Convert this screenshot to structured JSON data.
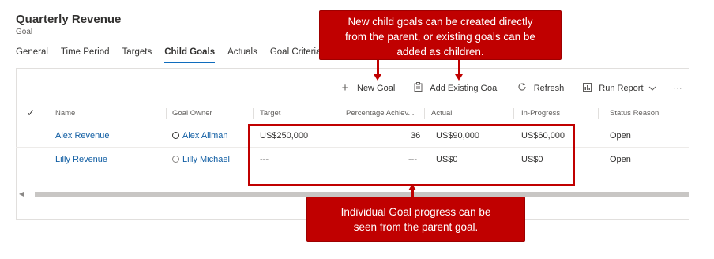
{
  "header": {
    "title": "Quarterly Revenue",
    "subtitle": "Goal"
  },
  "tabs": [
    {
      "label": "General"
    },
    {
      "label": "Time Period"
    },
    {
      "label": "Targets"
    },
    {
      "label": "Child Goals"
    },
    {
      "label": "Actuals"
    },
    {
      "label": "Goal Criteria"
    }
  ],
  "toolbar": {
    "new_goal": "New Goal",
    "add_existing_goal": "Add Existing Goal",
    "refresh": "Refresh",
    "run_report": "Run Report",
    "more": "···"
  },
  "columns": {
    "check": "✓",
    "name": "Name",
    "goal_owner": "Goal Owner",
    "target": "Target",
    "percentage": "Percentage Achiev...",
    "actual": "Actual",
    "in_progress": "In-Progress",
    "status_reason": "Status Reason"
  },
  "rows": [
    {
      "name": "Alex Revenue",
      "owner": "Alex Allman",
      "target": "US$250,000",
      "percentage": "36",
      "actual": "US$90,000",
      "in_progress": "US$60,000",
      "status": "Open"
    },
    {
      "name": "Lilly Revenue",
      "owner": "Lilly Michael",
      "target": "---",
      "percentage": "---",
      "actual": "US$0",
      "in_progress": "US$0",
      "status": "Open"
    }
  ],
  "callouts": {
    "top_line1": "New child goals can be created directly",
    "top_line2": "from the parent, or existing goals can be",
    "top_line3": "added as children.",
    "bottom_line1": "Individual Goal progress can be",
    "bottom_line2": "seen from the parent goal."
  },
  "colors": {
    "accent": "#c00000",
    "link": "#115ea3",
    "tab_underline": "#0f6cbd"
  }
}
